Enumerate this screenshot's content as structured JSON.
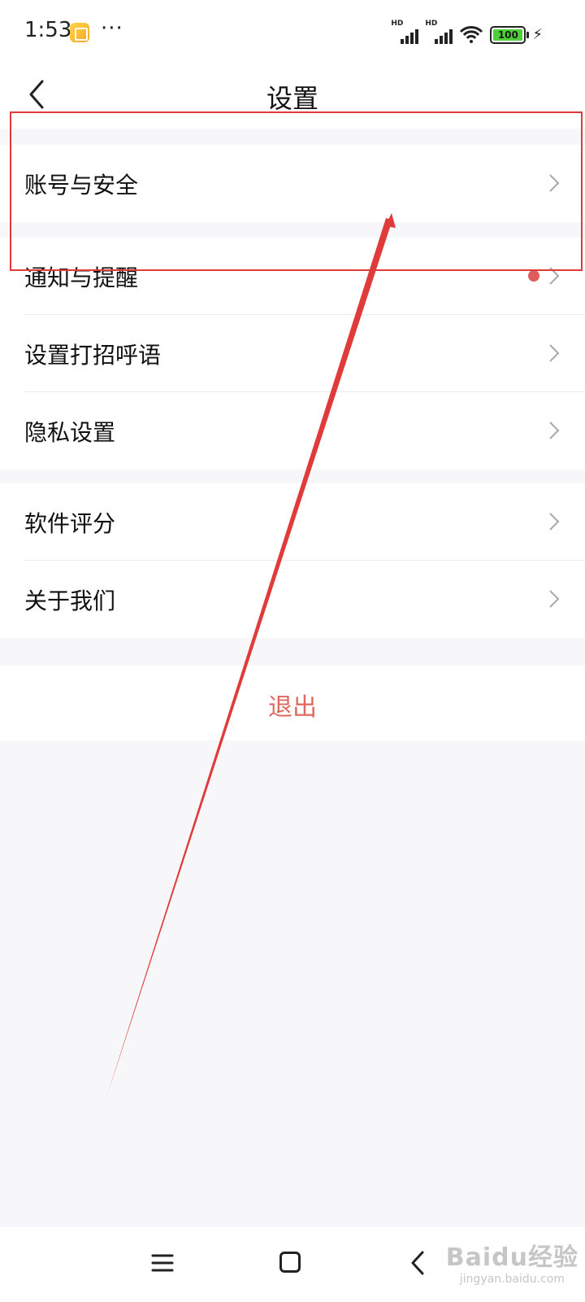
{
  "status_bar": {
    "time": "1:53",
    "more": "···",
    "sim1_label": "HD",
    "sim2_label": "HD",
    "battery": "100",
    "icons": [
      "app-notification-icon",
      "signal-icon",
      "wifi-icon",
      "battery-icon",
      "charging-icon"
    ]
  },
  "header": {
    "title": "设置",
    "back_icon": "chevron-left-icon"
  },
  "groups": {
    "account": {
      "items": [
        {
          "label": "账号与安全",
          "icon": "chevron-right-icon"
        }
      ]
    },
    "general": {
      "items": [
        {
          "label": "通知与提醒",
          "icon": "chevron-right-icon",
          "badge_color": "#e05c5c"
        },
        {
          "label": "设置打招呼语",
          "icon": "chevron-right-icon"
        },
        {
          "label": "隐私设置",
          "icon": "chevron-right-icon"
        }
      ]
    },
    "about": {
      "items": [
        {
          "label": "软件评分",
          "icon": "chevron-right-icon"
        },
        {
          "label": "关于我们",
          "icon": "chevron-right-icon"
        }
      ]
    }
  },
  "logout": {
    "label": "退出",
    "color": "#e0685f"
  },
  "nav_bar": {
    "icons": [
      "menu-icon",
      "home-icon",
      "back-icon"
    ]
  },
  "watermark": {
    "line1": "Baidu经验",
    "line2": "jingyan.baidu.com"
  },
  "annotation": {
    "color": "#e03a3a"
  }
}
